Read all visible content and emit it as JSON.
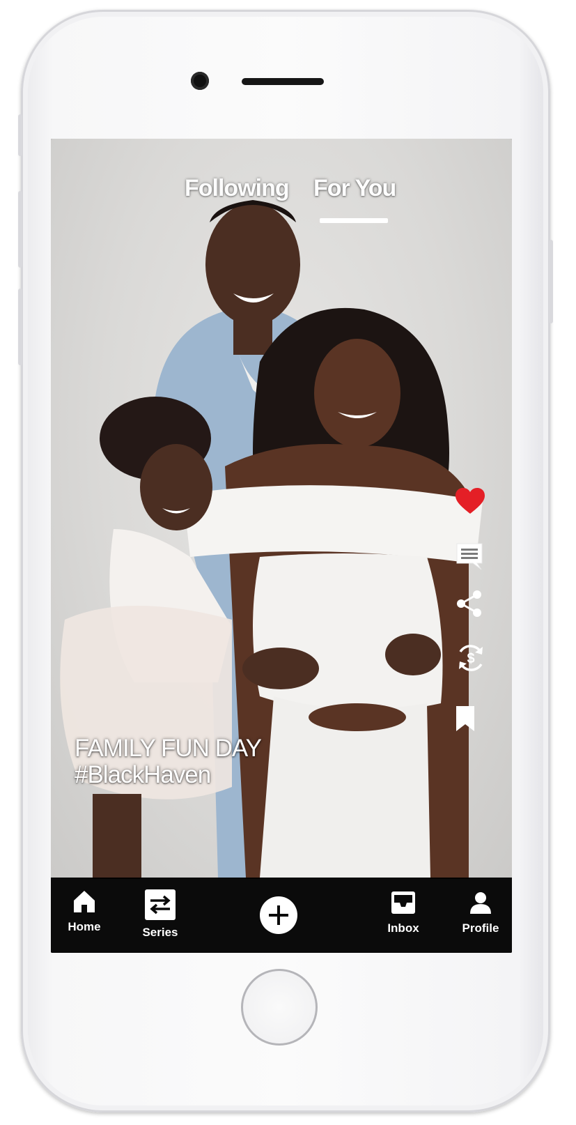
{
  "top_tabs": {
    "following": "Following",
    "for_you": "For You",
    "active": "For You"
  },
  "caption": {
    "title": "FAMILY FUN DAY",
    "hashtag": "#BlackHaven"
  },
  "actions": [
    {
      "icon": "heart-icon",
      "active": true,
      "color": "#e41f26"
    },
    {
      "icon": "comment-icon"
    },
    {
      "icon": "share-icon"
    },
    {
      "icon": "dollar-refresh-icon"
    },
    {
      "icon": "bookmark-icon"
    }
  ],
  "bottom_nav": {
    "home": "Home",
    "series": "Series",
    "inbox": "Inbox",
    "profile": "Profile"
  },
  "colors": {
    "nav_background": "#0b0b0b",
    "accent_heart": "#e41f26",
    "text": "#ffffff"
  }
}
